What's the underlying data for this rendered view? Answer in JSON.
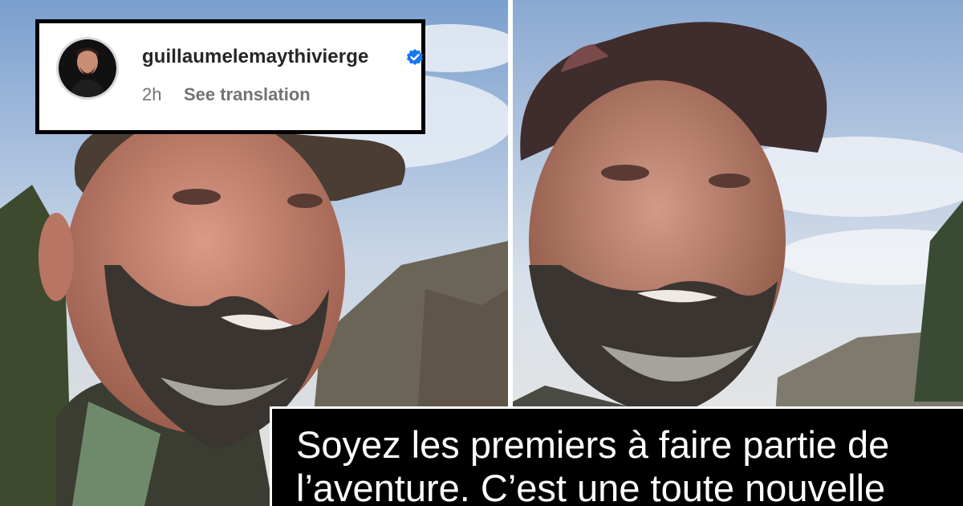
{
  "post_header": {
    "username": "guillaumelemaythivierge",
    "time": "2h",
    "see_translation": "See translation",
    "verified_icon": "verified-badge-icon",
    "accent_color": "#1877f2"
  },
  "caption": {
    "text": "Soyez les premiers à faire partie de l’aventure. C’est une toute nouvelle"
  },
  "colors": {
    "card_border": "#000000",
    "caption_bg": "#000000",
    "caption_text": "#ffffff",
    "meta_text": "#737373"
  }
}
